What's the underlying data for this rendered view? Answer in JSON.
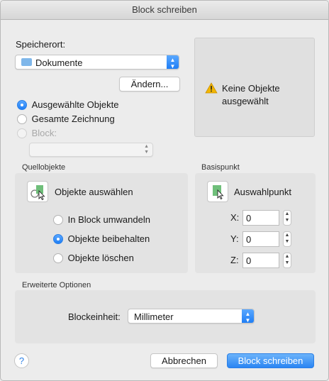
{
  "window": {
    "title": "Block schreiben"
  },
  "storage": {
    "label": "Speicherort:",
    "folder_value": "Dokumente",
    "change_button": "Ändern...",
    "options": [
      {
        "label": "Ausgewählte Objekte",
        "selected": true,
        "disabled": false
      },
      {
        "label": "Gesamte Zeichnung",
        "selected": false,
        "disabled": false
      },
      {
        "label": "Block:",
        "selected": false,
        "disabled": true
      }
    ],
    "block_value": ""
  },
  "preview": {
    "message": "Keine Objekte ausgewählt",
    "icon": "warning-icon"
  },
  "source": {
    "title": "Quellobjekte",
    "select_button": "Objekte auswählen",
    "options": [
      {
        "label": "In Block umwandeln",
        "selected": false
      },
      {
        "label": "Objekte beibehalten",
        "selected": true
      },
      {
        "label": "Objekte löschen",
        "selected": false
      }
    ]
  },
  "base_point": {
    "title": "Basispunkt",
    "pick_button": "Auswahlpunkt",
    "x_label": "X:",
    "x_value": "0",
    "y_label": "Y:",
    "y_value": "0",
    "z_label": "Z:",
    "z_value": "0"
  },
  "advanced": {
    "title": "Erweiterte Optionen",
    "unit_label": "Blockeinheit:",
    "unit_value": "Millimeter"
  },
  "footer": {
    "help_label": "?",
    "cancel_button": "Abbrechen",
    "ok_button": "Block schreiben"
  },
  "colors": {
    "accent": "#2a85f3",
    "warning": "#f2b600",
    "block_green": "#6fbf7a"
  }
}
